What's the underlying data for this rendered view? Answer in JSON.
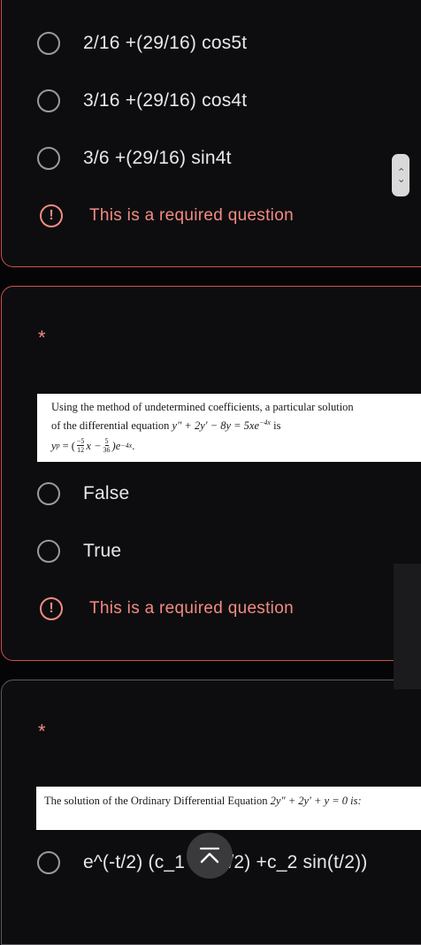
{
  "q1": {
    "options": [
      {
        "label": "2/16 +(29/16) cos5t"
      },
      {
        "label": "3/16 +(29/16) cos4t"
      },
      {
        "label": "3/6 +(29/16) sin4t"
      }
    ],
    "error_icon": "!",
    "error_text": "This is a required question"
  },
  "q2": {
    "required_marker": "*",
    "image_text": {
      "line1": "Using the method of undetermined coefficients, a particular solution",
      "line2_prefix": "of the differential equation",
      "line2_equation": "y″ + 2y′ − 8y = 5xe",
      "line2_exponent": "−4x",
      "line2_suffix": "is",
      "line3_lhs": "y",
      "line3_sub": "p",
      "line3_eq": "= (",
      "frac1_num": "−5",
      "frac1_den": "12",
      "line3_mid": "x −",
      "frac2_num": "5",
      "frac2_den": "36",
      "line3_tail": ")e",
      "line3_exponent": "−4x",
      "line3_end": "."
    },
    "options": [
      {
        "label": "False"
      },
      {
        "label": "True"
      }
    ],
    "error_icon": "!",
    "error_text": "This is a required question"
  },
  "q3": {
    "required_marker": "*",
    "image_text": {
      "prefix": "The solution of the Ordinary Differential Equation",
      "equation": "2y″ + 2y′ + y = 0 is:"
    },
    "options": [
      {
        "label_left": "e^(-t/2) (c_1",
        "label_right": "(t/2) +c_2 sin(t/2))"
      }
    ]
  },
  "scroll_control": {
    "up": "‹",
    "down": "›"
  },
  "icons": {
    "fab": "chevron-up-to-top-icon",
    "error": "exclamation-circle-icon",
    "scroll": "scroll-arrows-icon"
  }
}
